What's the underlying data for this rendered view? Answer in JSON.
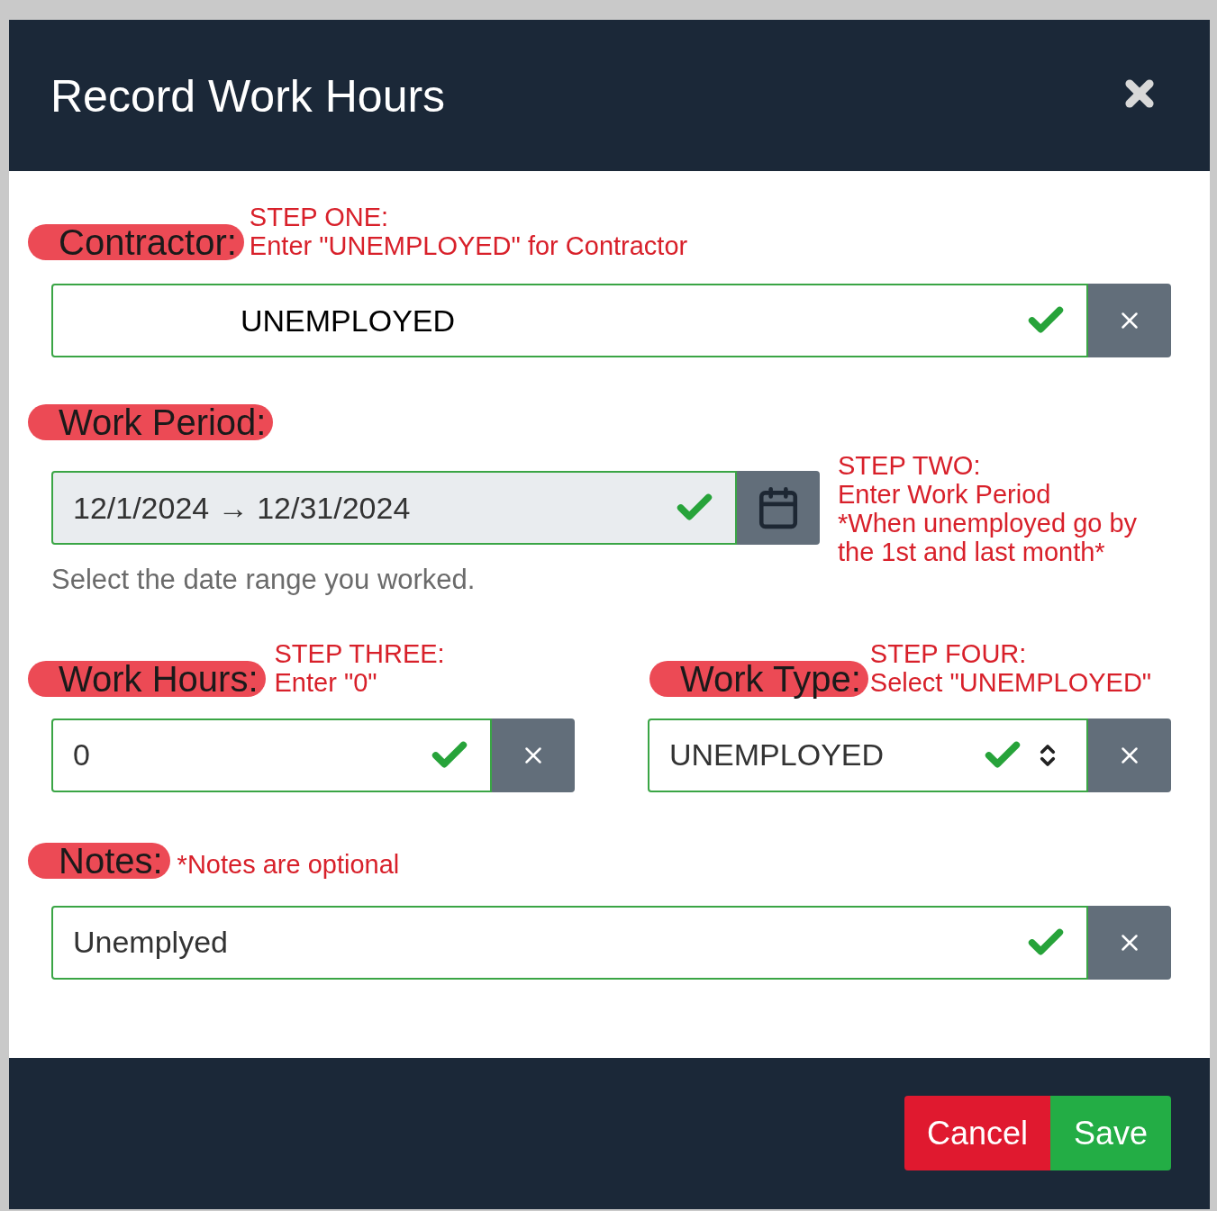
{
  "dialog": {
    "title": "Record Work Hours"
  },
  "contractor": {
    "label": "Contractor:",
    "annotation": [
      "STEP ONE:",
      "Enter \"UNEMPLOYED\" for Contractor"
    ],
    "field": {
      "kind": "text",
      "value": "UNEMPLOYED",
      "valid": true,
      "centered": true
    }
  },
  "work_period": {
    "label": "Work Period:",
    "annotation": [
      "STEP TWO:",
      "Enter Work Period",
      "*When unemployed go by",
      "the 1st and last month*"
    ],
    "field": {
      "kind": "date",
      "value": "12/1/2024 → 12/31/2024",
      "valid": true
    },
    "help": "Select the date range you worked."
  },
  "work_hours": {
    "label": "Work Hours:",
    "annotation": [
      "STEP THREE:",
      "Enter \"0\""
    ],
    "field": {
      "kind": "text",
      "value": "0",
      "valid": true
    }
  },
  "work_type": {
    "label": "Work Type:",
    "annotation": [
      "STEP FOUR:",
      "Select \"UNEMPLOYED\""
    ],
    "field": {
      "kind": "select",
      "value": "UNEMPLOYED",
      "valid": true
    }
  },
  "notes": {
    "label": "Notes:",
    "annotation": [
      "*Notes are optional"
    ],
    "field": {
      "kind": "text",
      "value": "Unemplyed",
      "valid": true
    }
  },
  "buttons": [
    {
      "label": "Cancel",
      "kind": "cancel"
    },
    {
      "label": "Save",
      "kind": "save"
    }
  ]
}
